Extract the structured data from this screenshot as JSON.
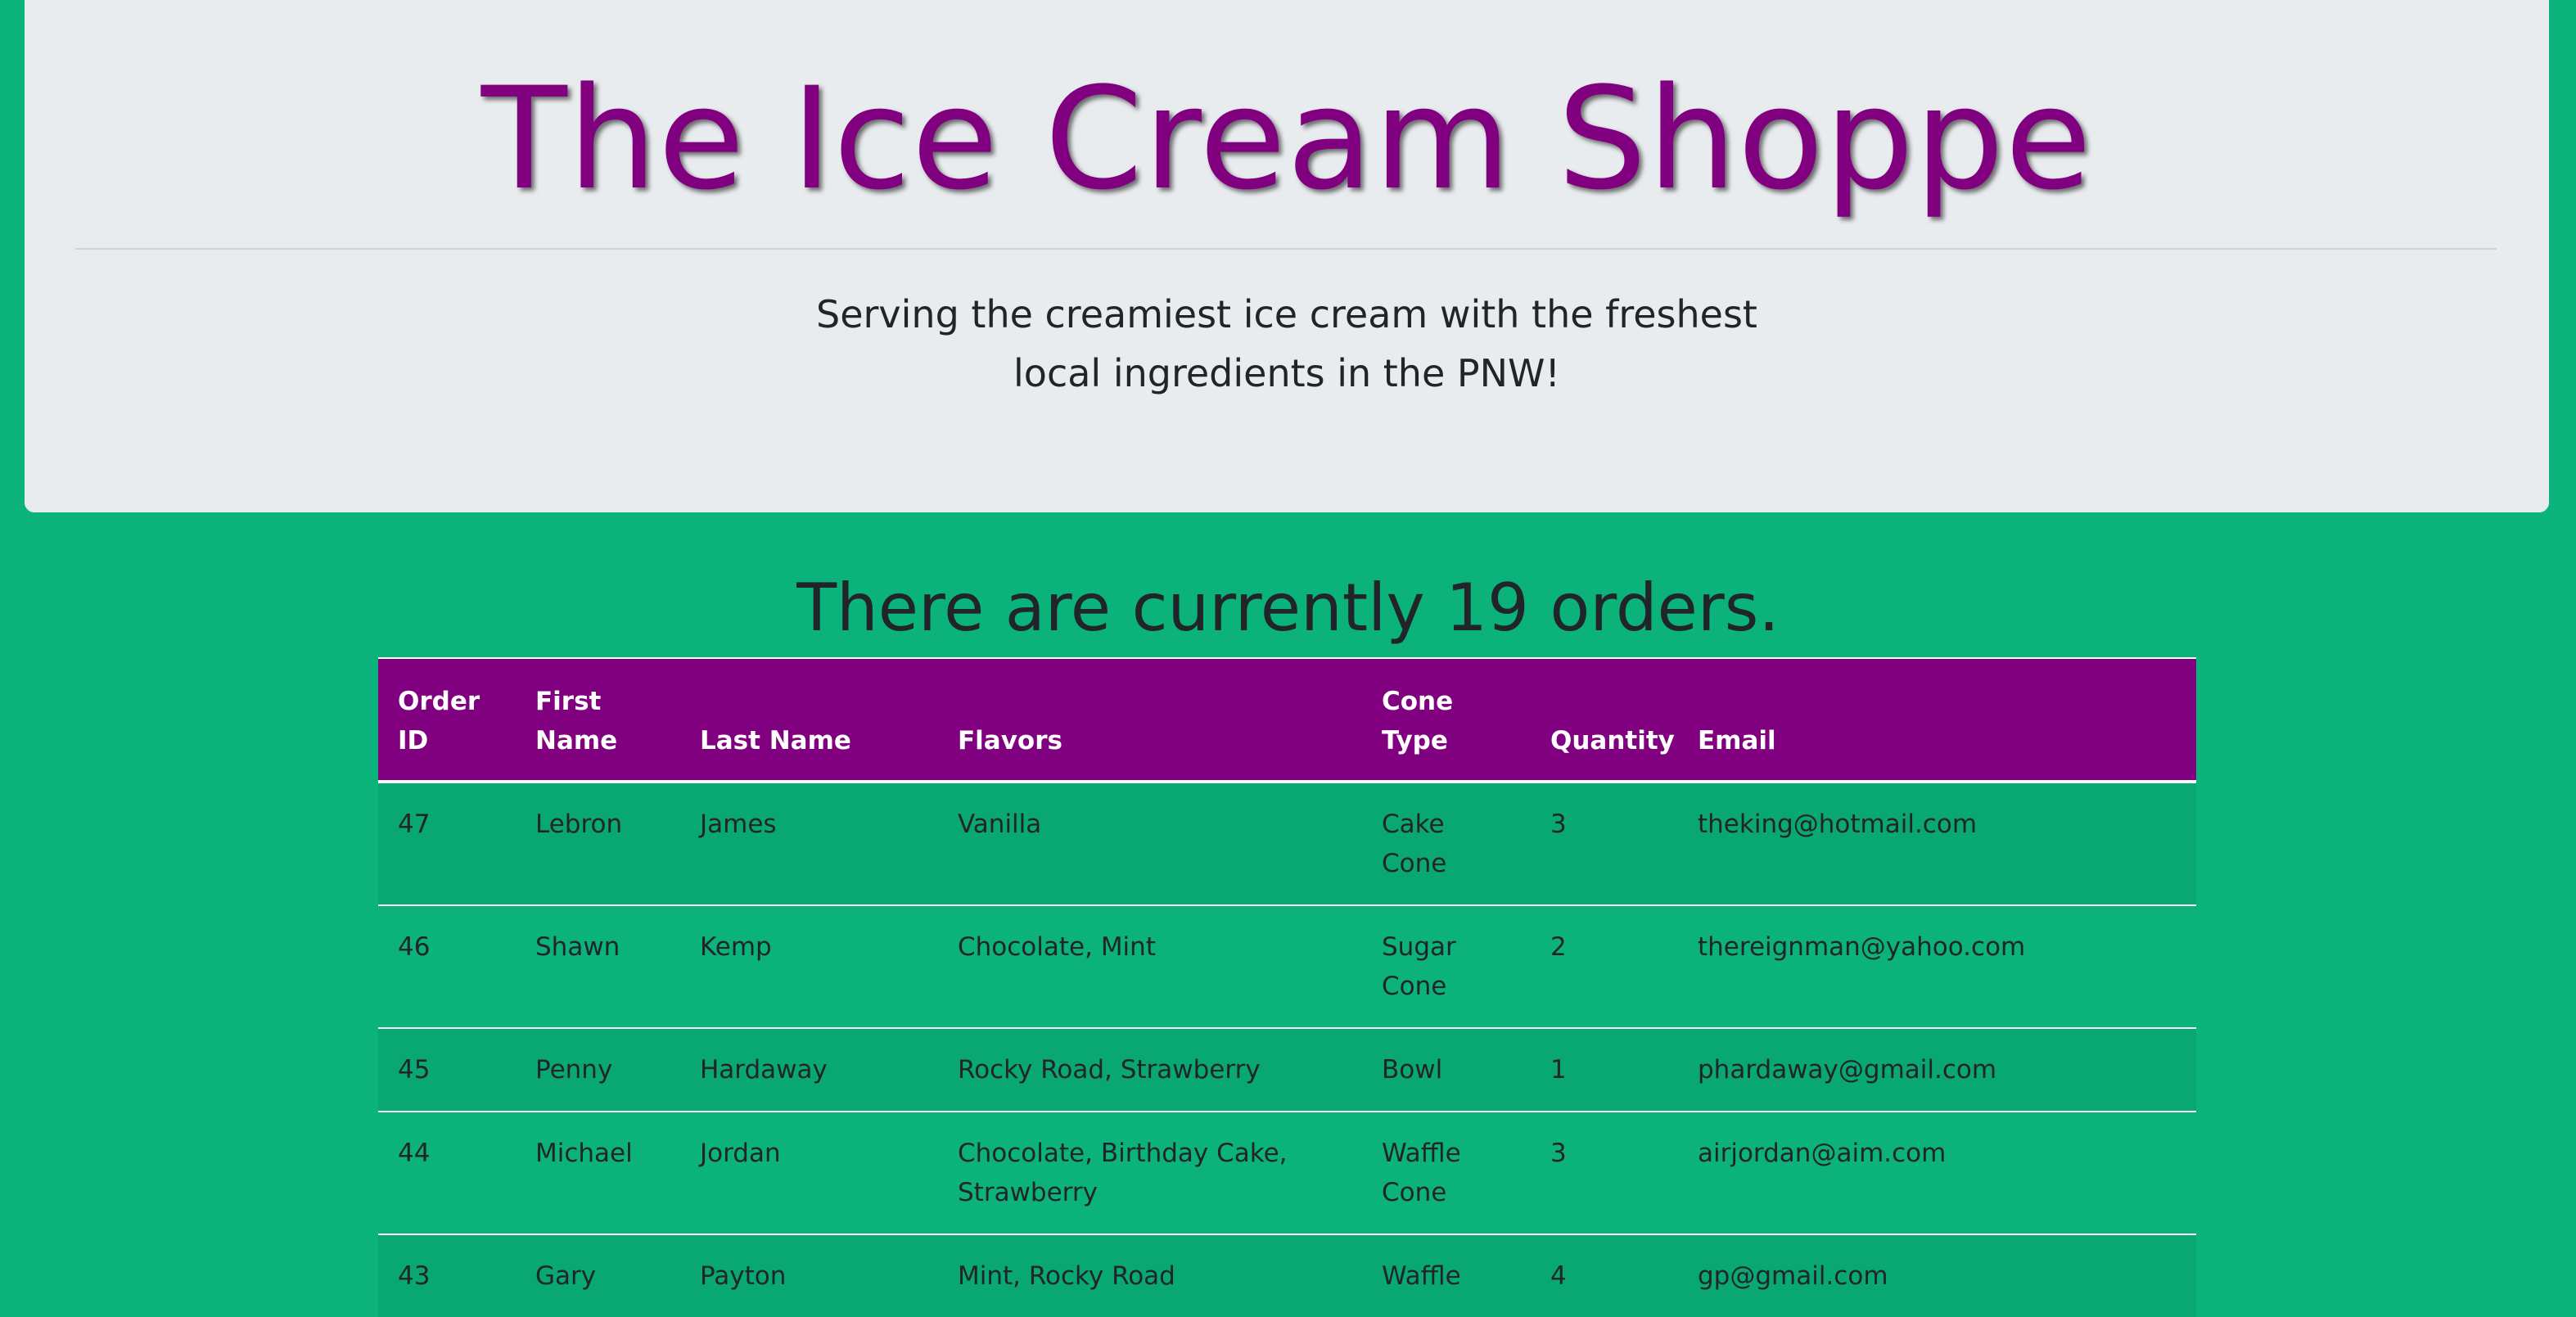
{
  "header": {
    "title": "The Ice Cream Shoppe",
    "tagline_line1": "Serving the creamiest ice cream with the freshest",
    "tagline_line2": "local ingredients in the PNW!"
  },
  "orders": {
    "heading": "There are currently 19 orders.",
    "columns": {
      "order_id_l1": "Order",
      "order_id_l2": "ID",
      "first_name_l1": "First",
      "first_name_l2": "Name",
      "last_name": "Last Name",
      "flavors": "Flavors",
      "cone_type": "Cone Type",
      "quantity": "Quantity",
      "email": "Email"
    },
    "rows": [
      {
        "id": "47",
        "first": "Lebron",
        "last": "James",
        "flavors": "Vanilla",
        "cone": "Cake Cone",
        "qty": "3",
        "email": "theking@hotmail.com"
      },
      {
        "id": "46",
        "first": "Shawn",
        "last": "Kemp",
        "flavors": "Chocolate, Mint",
        "cone": "Sugar Cone",
        "qty": "2",
        "email": "thereignman@yahoo.com"
      },
      {
        "id": "45",
        "first": "Penny",
        "last": "Hardaway",
        "flavors": "Rocky Road, Strawberry",
        "cone": "Bowl",
        "qty": "1",
        "email": "phardaway@gmail.com"
      },
      {
        "id": "44",
        "first": "Michael",
        "last": "Jordan",
        "flavors": "Chocolate, Birthday Cake, Strawberry",
        "cone": "Waffle Cone",
        "qty": "3",
        "email": "airjordan@aim.com"
      },
      {
        "id": "43",
        "first": "Gary",
        "last": "Payton",
        "flavors": "Mint, Rocky Road",
        "cone": "Waffle",
        "qty": "4",
        "email": "gp@gmail.com"
      }
    ]
  }
}
